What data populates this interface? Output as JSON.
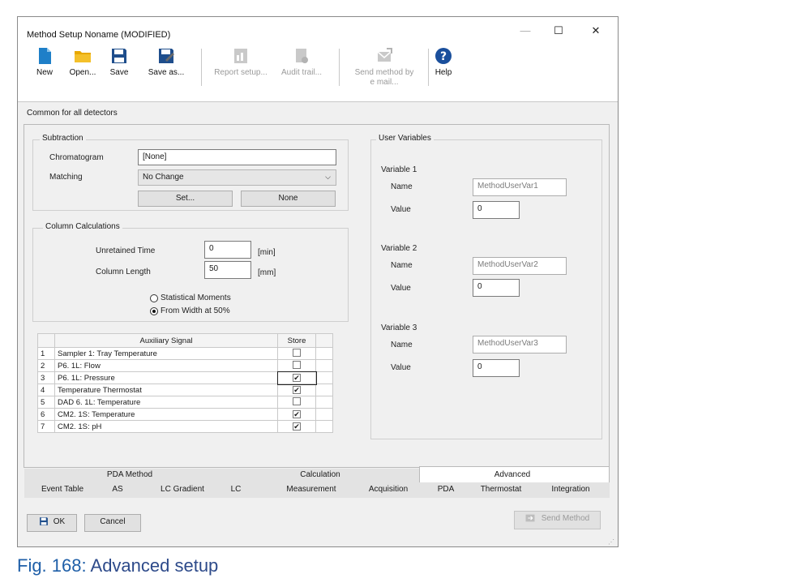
{
  "window": {
    "title": "Method Setup Noname (MODIFIED)",
    "controls": {
      "minimize": "—",
      "maximize": "☐",
      "close": "✕"
    }
  },
  "toolbar": {
    "new": "New",
    "open": "Open...",
    "save": "Save",
    "save_as": "Save as...",
    "report_setup": "Report setup...",
    "audit_trail": "Audit trail...",
    "send_by_email_1": "Send method by",
    "send_by_email_2": "e mail...",
    "help": "Help"
  },
  "section_label": "Common for all detectors",
  "subtraction": {
    "title": "Subtraction",
    "chromatogram_label": "Chromatogram",
    "chromatogram_value": "[None]",
    "matching_label": "Matching",
    "matching_value": "No Change",
    "set_button": "Set...",
    "none_button": "None"
  },
  "column_calc": {
    "title": "Column Calculations",
    "unretained_label": "Unretained Time",
    "unretained_value": "0",
    "unretained_unit": "[min]",
    "length_label": "Column Length",
    "length_value": "50",
    "length_unit": "[mm]",
    "radio_statistical": "Statistical Moments",
    "radio_width": "From Width at 50%",
    "selected": "width"
  },
  "aux_table": {
    "header_signal": "Auxiliary Signal",
    "header_store": "Store",
    "rows": [
      {
        "num": "1",
        "signal": "Sampler 1: Tray Temperature",
        "store": ""
      },
      {
        "num": "2",
        "signal": "P6. 1L: Flow",
        "store": ""
      },
      {
        "num": "3",
        "signal": "P6. 1L: Pressure",
        "store": "✔"
      },
      {
        "num": "4",
        "signal": "Temperature Thermostat",
        "store": "✔"
      },
      {
        "num": "5",
        "signal": "DAD 6. 1L: Temperature",
        "store": ""
      },
      {
        "num": "6",
        "signal": "CM2. 1S: Temperature",
        "store": "✔"
      },
      {
        "num": "7",
        "signal": "CM2. 1S: pH",
        "store": "✔"
      }
    ]
  },
  "user_variables": {
    "title": "User Variables",
    "name_label": "Name",
    "value_label": "Value",
    "vars": [
      {
        "title": "Variable 1",
        "name": "MethodUserVar1",
        "value": "0"
      },
      {
        "title": "Variable 2",
        "name": "MethodUserVar2",
        "value": "0"
      },
      {
        "title": "Variable 3",
        "name": "MethodUserVar3",
        "value": "0"
      }
    ]
  },
  "tabs_row1": [
    "PDA Method",
    "Calculation",
    "Advanced"
  ],
  "tabs_row2": [
    "Event Table",
    "AS",
    "LC Gradient",
    "LC",
    "Measurement",
    "Acquisition",
    "PDA",
    "Thermostat",
    "Integration"
  ],
  "footer": {
    "ok": "OK",
    "cancel": "Cancel",
    "send_method": "Send Method"
  },
  "caption": {
    "fig": "Fig. 168:",
    "text": "Advanced setup"
  },
  "colors": {
    "accent_blue": "#1f5fa8",
    "folder_yellow": "#e8a800",
    "help_blue": "#1a4f9c"
  }
}
